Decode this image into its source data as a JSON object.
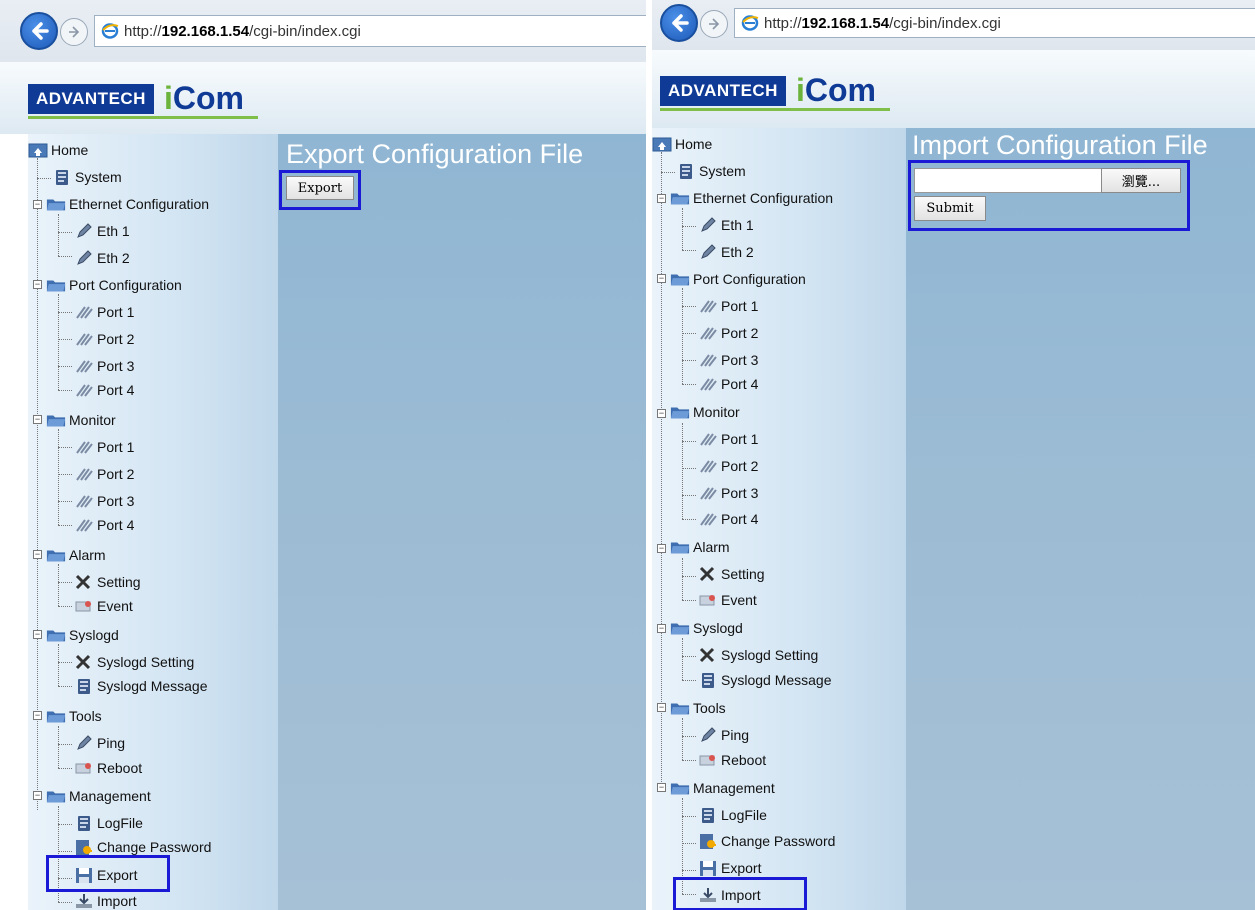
{
  "browser": {
    "url_prefix": "http://",
    "url_host": "192.168.1.54",
    "url_path": "/cgi-bin/index.cgi"
  },
  "brand": {
    "company": "ADVANTECH",
    "product_i": "i",
    "product_rest": "Com"
  },
  "nav": {
    "home": "Home",
    "system": "System",
    "ethernet": "Ethernet Configuration",
    "eth1": "Eth 1",
    "eth2": "Eth 2",
    "port_config": "Port Configuration",
    "port1": "Port 1",
    "port2": "Port 2",
    "port3": "Port 3",
    "port4": "Port 4",
    "monitor": "Monitor",
    "alarm": "Alarm",
    "setting": "Setting",
    "event": "Event",
    "syslogd": "Syslogd",
    "syslogd_setting": "Syslogd Setting",
    "syslogd_message": "Syslogd Message",
    "tools": "Tools",
    "ping": "Ping",
    "reboot": "Reboot",
    "management": "Management",
    "logfile": "LogFile",
    "change_password": "Change Password",
    "export": "Export",
    "import": "Import"
  },
  "export_page": {
    "title": "Export Configuration File",
    "button": "Export"
  },
  "import_page": {
    "title": "Import Configuration File",
    "file_value": "",
    "browse_button": "瀏覽...",
    "submit_button": "Submit"
  },
  "colors": {
    "highlight_border": "#1a1ad6",
    "brand_blue": "#0f3a95",
    "brand_green": "#6bb33b"
  }
}
